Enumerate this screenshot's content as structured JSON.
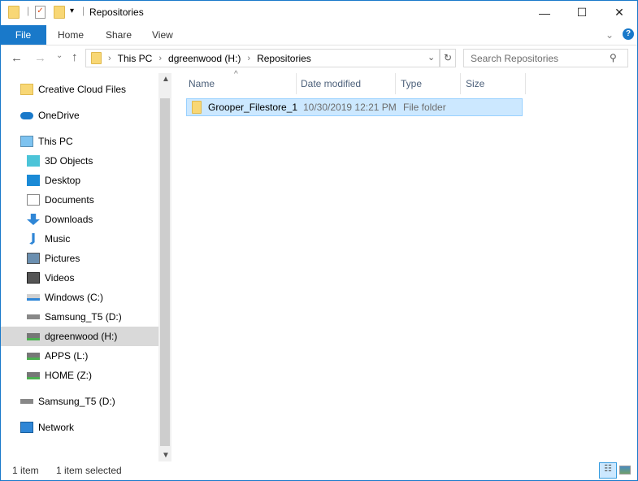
{
  "title": "Repositories",
  "ribbon": {
    "tabs": [
      "File",
      "Home",
      "Share",
      "View"
    ]
  },
  "address": {
    "crumbs": [
      "This PC",
      "dgreenwood (H:)",
      "Repositories"
    ],
    "search_placeholder": "Search Repositories"
  },
  "nav": [
    {
      "label": "Creative Cloud Files",
      "icon": "creative-cloud-icon",
      "level": 0
    },
    {
      "label": "OneDrive",
      "icon": "onedrive-icon",
      "level": 0
    },
    {
      "label": "This PC",
      "icon": "computer-icon",
      "level": 0
    },
    {
      "label": "3D Objects",
      "icon": "3d-objects-icon",
      "level": 1
    },
    {
      "label": "Desktop",
      "icon": "desktop-icon",
      "level": 1
    },
    {
      "label": "Documents",
      "icon": "documents-icon",
      "level": 1
    },
    {
      "label": "Downloads",
      "icon": "downloads-icon",
      "level": 1
    },
    {
      "label": "Music",
      "icon": "music-icon",
      "level": 1
    },
    {
      "label": "Pictures",
      "icon": "pictures-icon",
      "level": 1
    },
    {
      "label": "Videos",
      "icon": "videos-icon",
      "level": 1
    },
    {
      "label": "Windows (C:)",
      "icon": "drive-icon",
      "level": 1
    },
    {
      "label": "Samsung_T5 (D:)",
      "icon": "usb-drive-icon",
      "level": 1
    },
    {
      "label": "dgreenwood (H:)",
      "icon": "network-drive-icon",
      "level": 1,
      "selected": true
    },
    {
      "label": "APPS (L:)",
      "icon": "network-drive-icon",
      "level": 1
    },
    {
      "label": "HOME (Z:)",
      "icon": "network-drive-icon",
      "level": 1
    },
    {
      "label": "Samsung_T5 (D:)",
      "icon": "usb-drive-icon",
      "level": 0
    },
    {
      "label": "Network",
      "icon": "network-icon",
      "level": 0
    }
  ],
  "columns": [
    "Name",
    "Date modified",
    "Type",
    "Size"
  ],
  "files": [
    {
      "name": "Grooper_Filestore_1",
      "date": "10/30/2019 12:21 PM",
      "type": "File folder",
      "size": ""
    }
  ],
  "status": {
    "count": "1 item",
    "selected": "1 item selected"
  },
  "colors": {
    "accent": "#1979ca",
    "selection": "#cce8ff"
  }
}
